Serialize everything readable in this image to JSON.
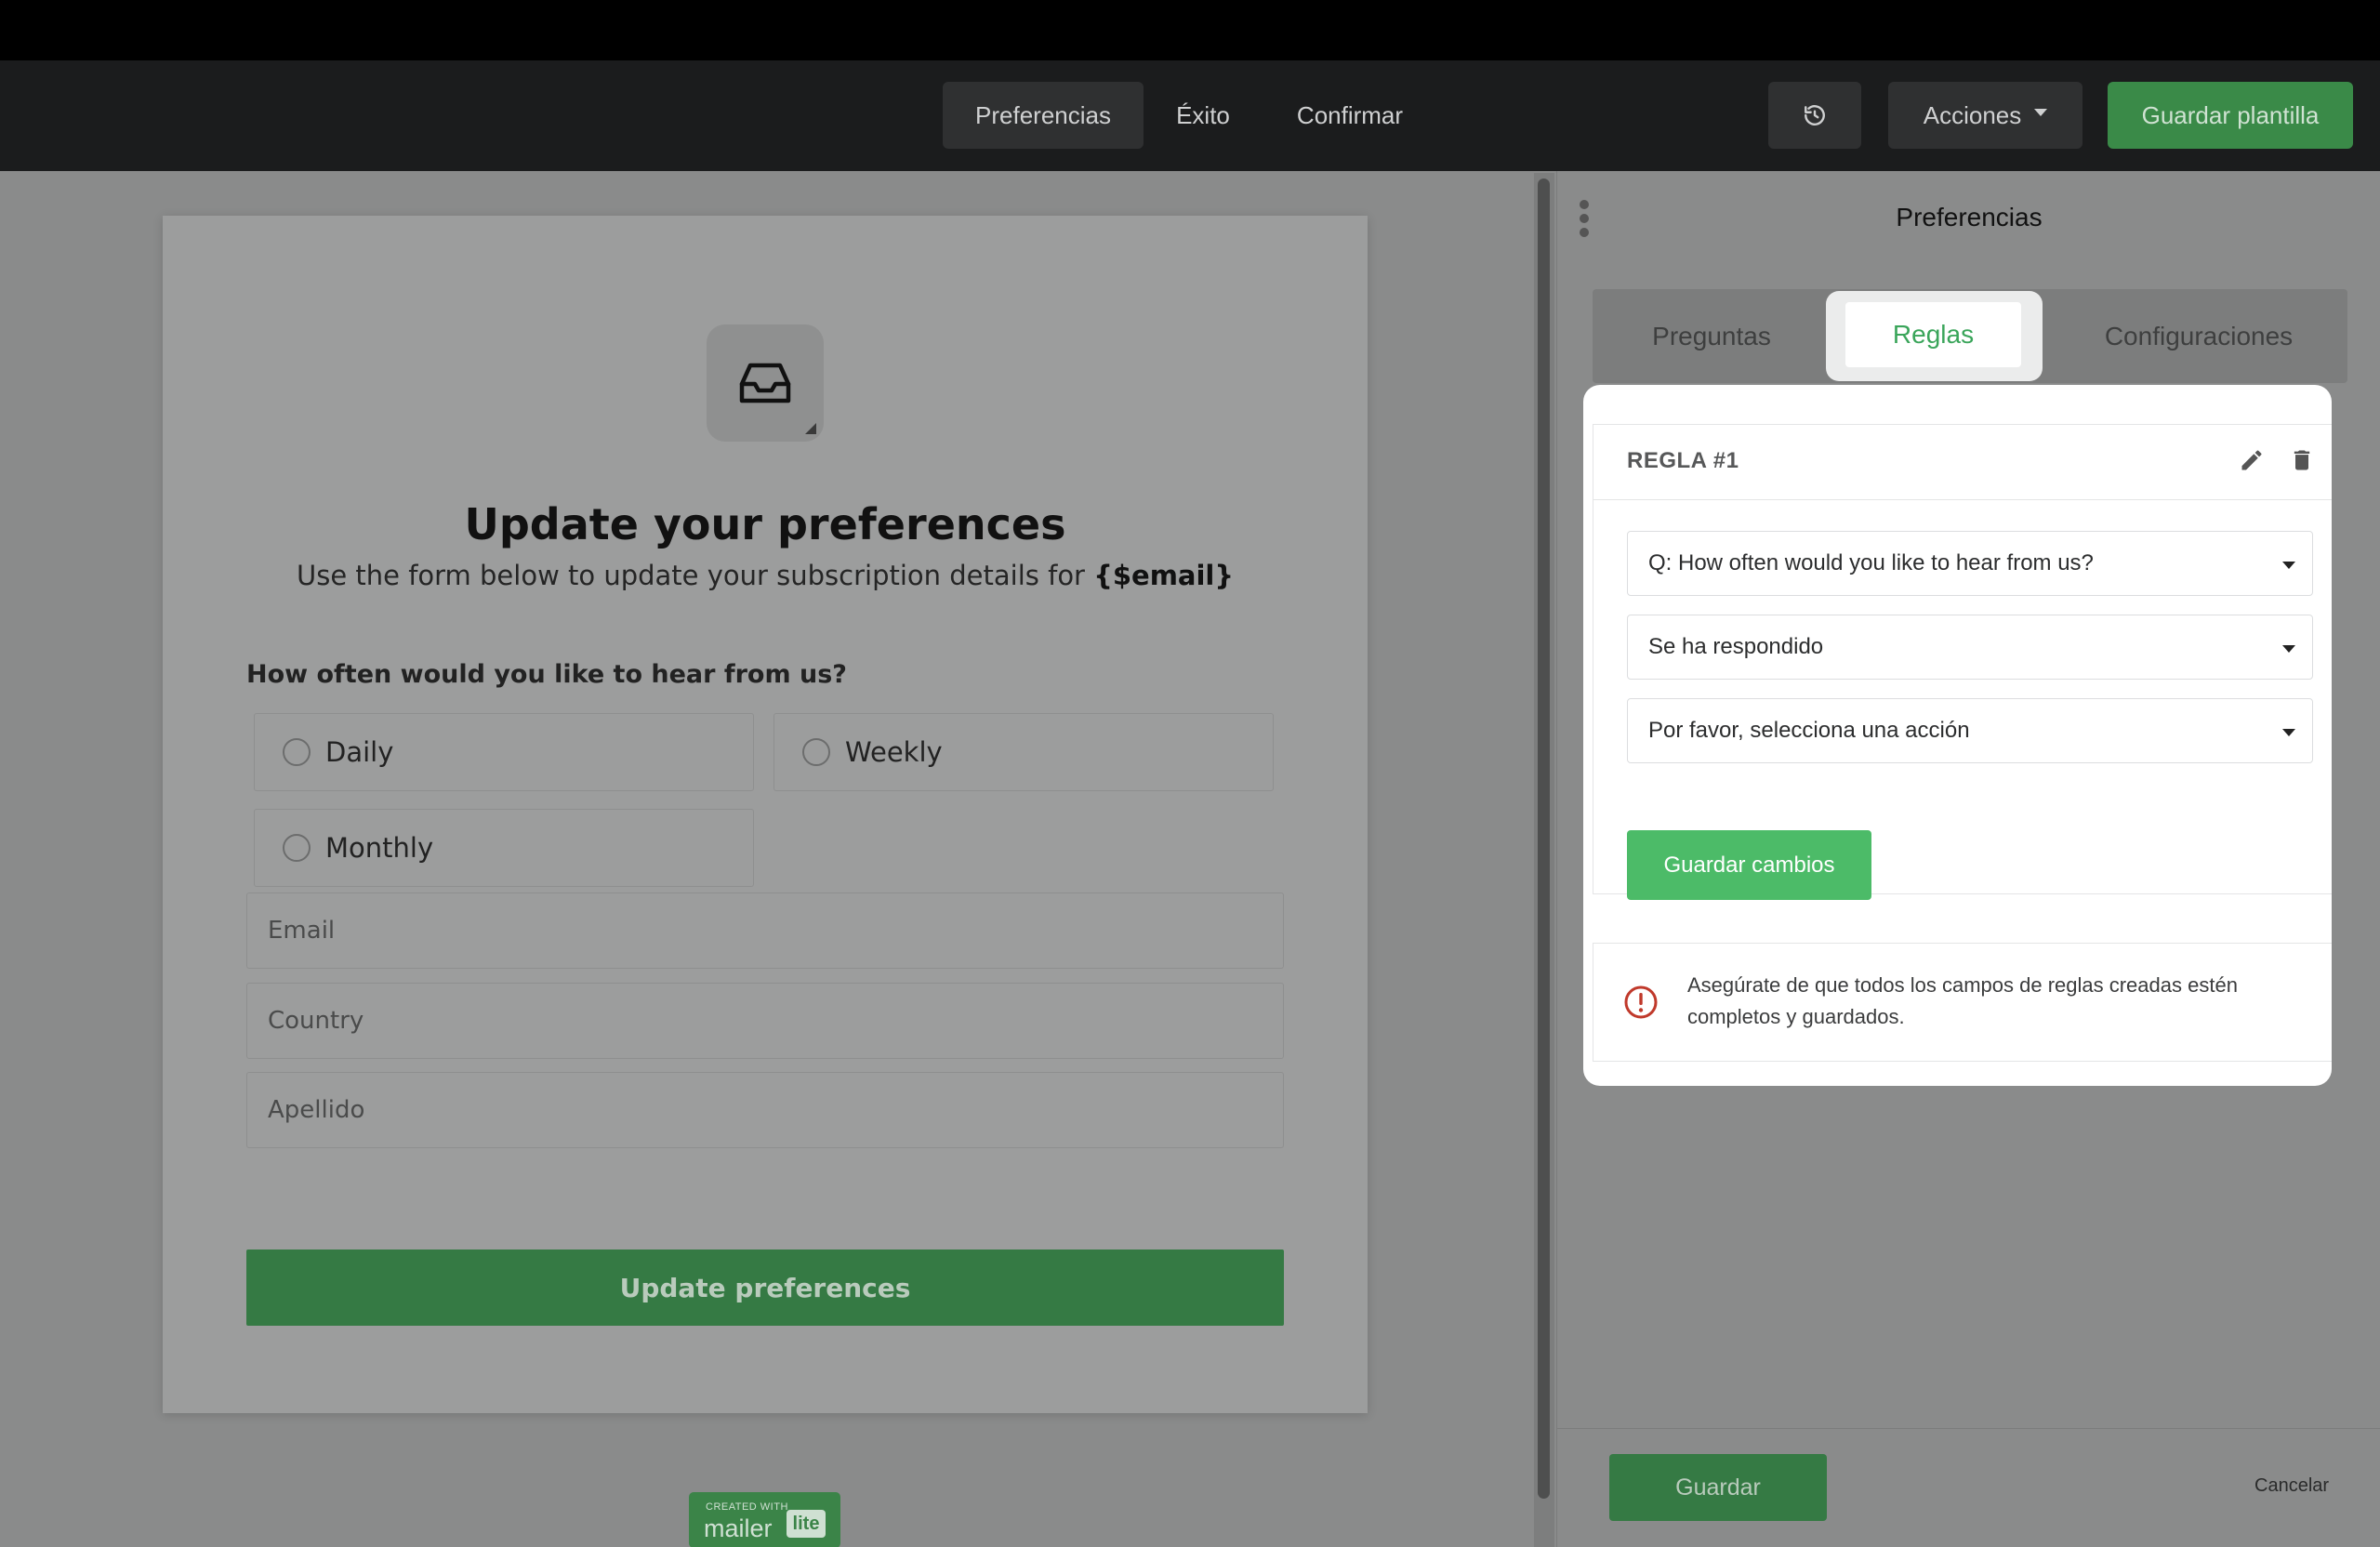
{
  "toolbar": {
    "tabs": [
      "Preferencias",
      "Éxito",
      "Confirmar"
    ],
    "history_icon": "history-icon",
    "actions_label": "Acciones",
    "save_template_label": "Guardar plantilla"
  },
  "form": {
    "logo_icon": "inbox-icon",
    "title": "Update your preferences",
    "subtitle_prefix": "Use the form below to update your subscription details for ",
    "subtitle_tag": "{$email}",
    "question": "How often would you like to hear from us?",
    "options": [
      "Daily",
      "Weekly",
      "Monthly"
    ],
    "fields": [
      "Email",
      "Country",
      "Apellido"
    ],
    "submit_label": "Update preferences",
    "badge": {
      "small": "CREATED WITH",
      "big": "mailer",
      "lite": "lite"
    }
  },
  "panel": {
    "title": "Preferencias",
    "tabs": [
      "Preguntas",
      "Reglas",
      "Configuraciones"
    ],
    "active_tab": "Reglas",
    "rule": {
      "title": "REGLA #1",
      "question_select": "Q: How often would you like to hear from us?",
      "condition_select": "Se ha respondido",
      "action_select": "Por favor, selecciona una acción",
      "save_changes_label": "Guardar cambios"
    },
    "alert_text": "Asegúrate de que todos los campos de reglas creadas estén completos y guardados.",
    "save_label": "Guardar",
    "cancel_label": "Cancelar"
  },
  "colors": {
    "accent_green": "#4cbb68",
    "dark_green": "#357a44",
    "alert_red": "#c0392b"
  }
}
